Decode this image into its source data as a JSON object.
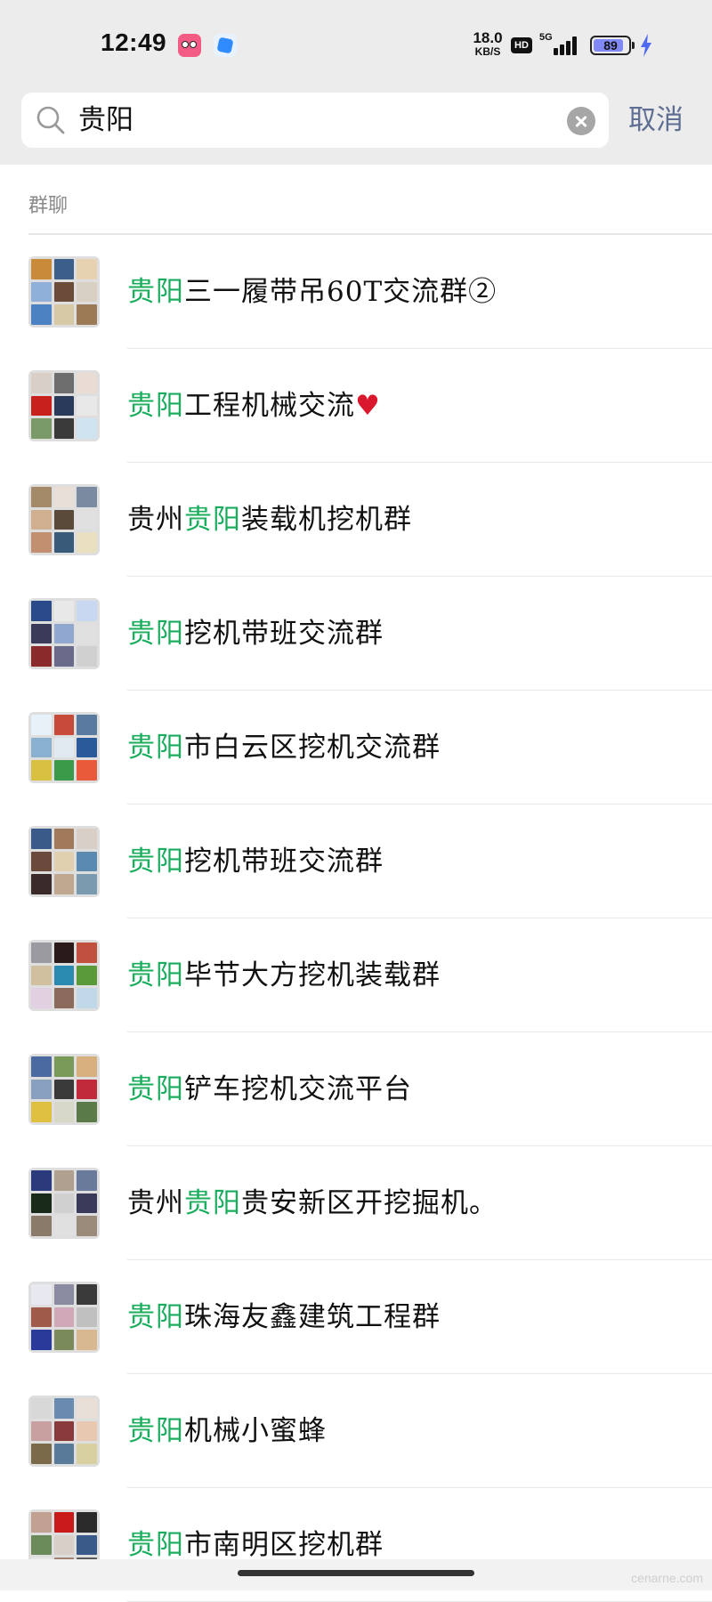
{
  "status_bar": {
    "time": "12:49",
    "net_speed_value": "18.0",
    "net_speed_unit": "KB/S",
    "hd_badge": "HD",
    "network_type": "5G",
    "battery_level": "89",
    "battery_fraction": 0.89
  },
  "search": {
    "query": "贵阳",
    "cancel_label": "取消"
  },
  "section_title": "群聊",
  "highlight_color": "#1aad5d",
  "results": [
    {
      "prefix": "",
      "highlight": "贵阳",
      "suffix": "三一履带吊60T交流群②"
    },
    {
      "prefix": "",
      "highlight": "贵阳",
      "suffix": "工程机械交流",
      "emoji": "❤️"
    },
    {
      "prefix": "贵州",
      "highlight": "贵阳",
      "suffix": "装载机挖机群"
    },
    {
      "prefix": "",
      "highlight": "贵阳",
      "suffix": "挖机带班交流群"
    },
    {
      "prefix": "",
      "highlight": "贵阳",
      "suffix": "市白云区挖机交流群"
    },
    {
      "prefix": "",
      "highlight": "贵阳",
      "suffix": "挖机带班交流群"
    },
    {
      "prefix": "",
      "highlight": "贵阳",
      "suffix": "毕节大方挖机装载群"
    },
    {
      "prefix": "",
      "highlight": "贵阳",
      "suffix": "铲车挖机交流平台"
    },
    {
      "prefix": "贵州",
      "highlight": "贵阳",
      "suffix": "贵安新区开挖掘机。"
    },
    {
      "prefix": "",
      "highlight": "贵阳",
      "suffix": "珠海友鑫建筑工程群"
    },
    {
      "prefix": "",
      "highlight": "贵阳",
      "suffix": "机械小蜜蜂"
    },
    {
      "prefix": "",
      "highlight": "贵阳",
      "suffix": "市南明区挖机群"
    }
  ],
  "watermark": "cenarne.com"
}
